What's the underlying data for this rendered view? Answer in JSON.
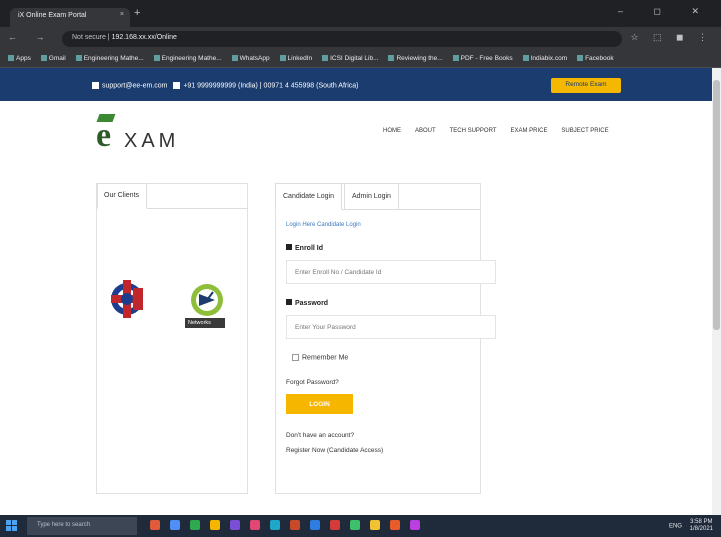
{
  "browser": {
    "tab_title": "iX Online Exam Portal",
    "tab_close": "×",
    "new_tab": "+",
    "window_controls": "– ◻ ✕",
    "nav_buttons": "← → ⟳ ⌂",
    "url_scheme": "Not secure | ",
    "url": "192.168.xx.xx/Online",
    "ext_icons": "☆ ⬚ ◼ ⋮",
    "bookmarks": [
      "Apps",
      "Gmail",
      "Engineering Mathe...",
      "Engineering Mathe...",
      "WhatsApp",
      "LinkedIn",
      "ICSI Digital Lib...",
      "Reviewing the...",
      "PDF - Free Books",
      "Indiabix.com",
      "Facebook"
    ]
  },
  "header": {
    "contact_email": "support@ee-em.com",
    "contact_phone": "+91 9999999999 (India) | 00971 4 455998 (South Africa)",
    "remote_button": "Remote Exam"
  },
  "brand": {
    "logo_letter": "e",
    "logo_text": "XAM"
  },
  "nav": {
    "items": [
      "HOME",
      "ABOUT",
      "TECH SUPPORT",
      "EXAM PRICE",
      "SUBJECT PRICE"
    ]
  },
  "clients": {
    "tab_label": "Our Clients",
    "logo_b_caption": "Networks"
  },
  "login": {
    "tabs": [
      "Candidate Login",
      "Admin Login"
    ],
    "subtitle": "Login Here Candidate Login",
    "roll_label": "Enroll Id",
    "roll_placeholder": "Enter Enroll No / Candidate Id",
    "password_label": "Password",
    "password_placeholder": "Enter Your Password",
    "remember_label": "Remember Me",
    "forgot_label": "Forgot Password?",
    "login_button": "LOGIN",
    "no_account": "Don't have an account?",
    "register_text": "Register Now (Candidate Access)"
  },
  "taskbar": {
    "search_placeholder": "Type here to search",
    "app_colors": [
      "#e05b3a",
      "#4f8ff7",
      "#2fa84f",
      "#f6b600",
      "#7a4fd6",
      "#e04872",
      "#1ea7c8",
      "#c94a2a",
      "#2f7de1",
      "#d43c3c",
      "#3ec06a",
      "#f1c232",
      "#e85c2c",
      "#ba3ee0"
    ],
    "tray_text": "ENG",
    "time": "3:58 PM",
    "date": "1/8/2021"
  },
  "colors": {
    "top_strip": "#1b3c6e",
    "accent_yellow": "#f6b600",
    "brand_green": "#2d5c2a"
  }
}
